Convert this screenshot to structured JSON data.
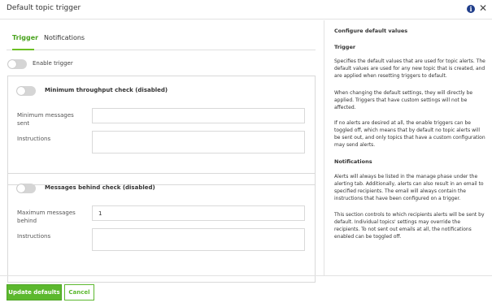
{
  "dialog": {
    "title": "Default topic trigger",
    "info_icon": "info-icon",
    "close_icon": "close-icon"
  },
  "tabs": [
    {
      "label": "Trigger",
      "active": true
    },
    {
      "label": "Notifications",
      "active": false
    }
  ],
  "enable_trigger": {
    "label": "Enable trigger",
    "on": false
  },
  "throughput": {
    "title": "Minimum throughput check (disabled)",
    "on": false,
    "min_messages_label": "Minimum messages sent",
    "min_messages_value": "",
    "instructions_label": "Instructions",
    "instructions_value": ""
  },
  "behind": {
    "title": "Messages behind check (disabled)",
    "on": false,
    "max_messages_label": "Maximum messages behind",
    "max_messages_value": "1",
    "instructions_label": "Instructions",
    "instructions_value": ""
  },
  "help": {
    "heading": "Configure default values",
    "trigger_heading": "Trigger",
    "p1": "Specifies the default values that are used for topic alerts. The default values are used for any new topic that is created, and are applied when resetting triggers to default.",
    "p2": "When changing the default settings, they will directly be applied. Triggers that have custom settings will not be affected.",
    "p3": "If no alerts are desired at all, the enable triggers can be toggled off, which means that by default no topic alerts will be sent out, and only topics that have a custom configuration may send alerts.",
    "notifications_heading": "Notifications",
    "p4": "Alerts will always be listed in the manage phase under the alerting tab. Additionally, alerts can also result in an email to specified recipients. The email will always contain the instructions that have been configured on a trigger.",
    "p5": "This section controls to which recipients alerts will be sent by default. Individual topics' settings may override the recipients. To not sent out emails at all, the notifications enabled can be toggled off."
  },
  "footer": {
    "update_label": "Update defaults",
    "cancel_label": "Cancel"
  },
  "colors": {
    "accent": "#5cb82e",
    "info": "#1f3d8a"
  }
}
